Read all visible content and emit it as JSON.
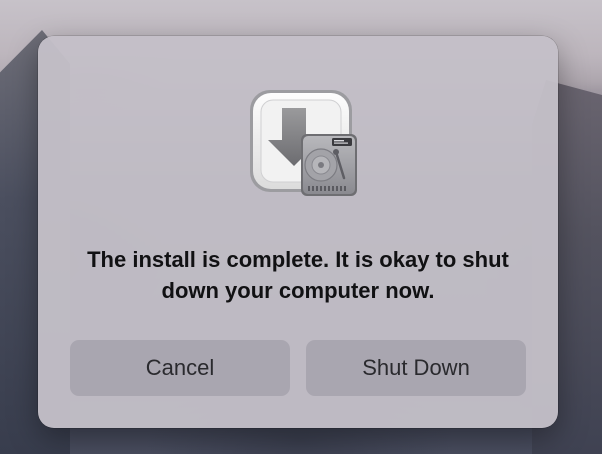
{
  "dialog": {
    "icon": "installer-download-to-disk-icon",
    "message": "The install is complete. It is okay to shut down your computer now.",
    "buttons": {
      "cancel_label": "Cancel",
      "shutdown_label": "Shut Down"
    }
  },
  "colors": {
    "dialog_background": "#c4c0c8",
    "button_background": "#a9a6b0",
    "message_text": "#111113",
    "button_text": "#2a2a2e"
  }
}
